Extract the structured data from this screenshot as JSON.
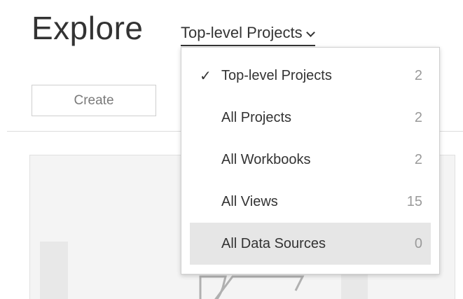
{
  "header": {
    "title": "Explore",
    "filter_label": "Top-level Projects"
  },
  "toolbar": {
    "create_label": "Create"
  },
  "dropdown": {
    "check_glyph": "✓",
    "items": [
      {
        "label": "Top-level Projects",
        "count": "2",
        "selected": true
      },
      {
        "label": "All Projects",
        "count": "2",
        "selected": false
      },
      {
        "label": "All Workbooks",
        "count": "2",
        "selected": false
      },
      {
        "label": "All Views",
        "count": "15",
        "selected": false
      },
      {
        "label": "All Data Sources",
        "count": "0",
        "selected": false,
        "hovered": true
      }
    ]
  },
  "icons": {
    "filter_chevron": "chevron-down-icon",
    "selected_mark": "check-icon",
    "card_graphic": "folder-icon"
  },
  "colors": {
    "text": "#333333",
    "muted_count": "#9a9a9a",
    "hover_bg": "#e6e6e6",
    "border": "#cfcfcf"
  }
}
